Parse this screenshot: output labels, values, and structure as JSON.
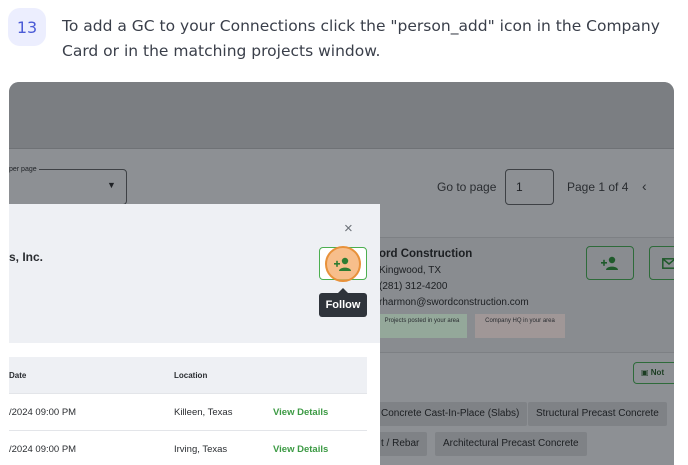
{
  "step": {
    "number": "13",
    "instruction": "To add a GC to your Connections click the \"person_add\" icon in the Company Card or in the matching projects window."
  },
  "colors": {
    "accent_green": "#4caf50",
    "highlight_orange": "#e8913a",
    "link_green": "#3c9a44"
  },
  "pagination": {
    "per_page_label": "per page",
    "goto_label": "Go to page",
    "goto_value": "1",
    "page_of": "Page 1 of 4",
    "prev_icon": "‹"
  },
  "company_card": {
    "name": "ord Construction",
    "city": "Kingwood, TX",
    "phone": "(281) 312-4200",
    "email": "rharmon@swordconstruction.com",
    "badge_projects": "Projects posted in your area",
    "badge_hq": "Company HQ in your area",
    "notes_label": "Not"
  },
  "tags": [
    "Concrete Cast-In-Place (Slabs)",
    "Structural Precast Concrete",
    "t / Rebar",
    "Architectural Precast Concrete"
  ],
  "modal": {
    "title": "s, Inc.",
    "close_icon": "×",
    "follow_tooltip": "Follow",
    "columns": [
      "Date",
      "Location"
    ],
    "rows": [
      {
        "date": "/2024 09:00 PM",
        "location": "Killeen, Texas",
        "action": "View Details"
      },
      {
        "date": "/2024 09:00 PM",
        "location": "Irving, Texas",
        "action": "View Details"
      }
    ]
  }
}
